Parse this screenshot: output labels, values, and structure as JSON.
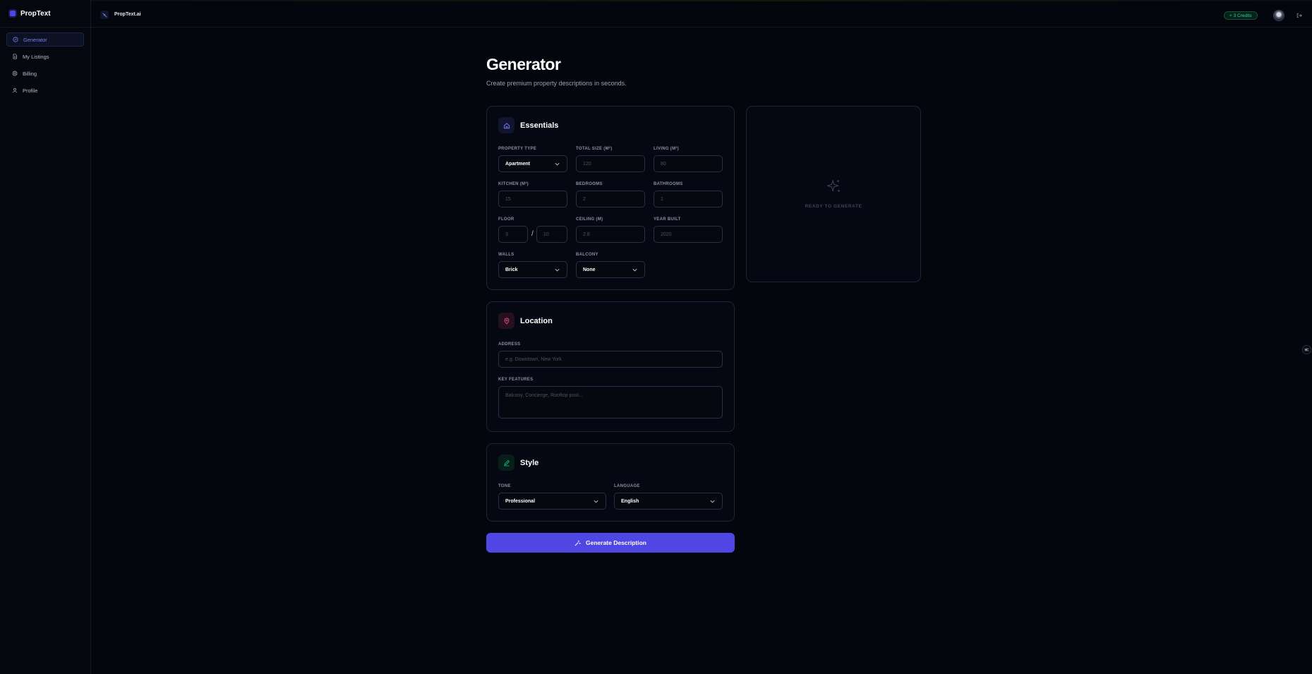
{
  "brand": {
    "name": "PropText"
  },
  "sidebar": {
    "items": [
      {
        "label": "Generator",
        "icon": "sparkle-icon"
      },
      {
        "label": "My Listings",
        "icon": "document-icon"
      },
      {
        "label": "Billing",
        "icon": "coin-icon"
      },
      {
        "label": "Profile",
        "icon": "user-icon"
      }
    ]
  },
  "topbar": {
    "title": "PropText.ai",
    "credits": "+ 3 Credits"
  },
  "page": {
    "title": "Generator",
    "subtitle": "Create premium property descriptions in seconds."
  },
  "essentials": {
    "title": "Essentials",
    "property_type": {
      "label": "PROPERTY TYPE",
      "value": "Apartment"
    },
    "total_size": {
      "label": "TOTAL SIZE (M²)",
      "placeholder": "120"
    },
    "living": {
      "label": "LIVING (M²)",
      "placeholder": "80"
    },
    "kitchen": {
      "label": "KITCHEN (M²)",
      "placeholder": "15"
    },
    "bedrooms": {
      "label": "BEDROOMS",
      "placeholder": "2"
    },
    "bathrooms": {
      "label": "BATHROOMS",
      "placeholder": "1"
    },
    "floor": {
      "label": "FLOOR",
      "placeholder": "3",
      "total_placeholder": "10",
      "separator": "/"
    },
    "ceiling": {
      "label": "CEILING (M)",
      "placeholder": "2.8"
    },
    "year_built": {
      "label": "YEAR BUILT",
      "placeholder": "2020"
    },
    "walls": {
      "label": "WALLS",
      "value": "Brick"
    },
    "balcony": {
      "label": "BALCONY",
      "value": "None"
    }
  },
  "location": {
    "title": "Location",
    "address": {
      "label": "ADDRESS",
      "placeholder": "e.g. Downtown, New York"
    },
    "key_features": {
      "label": "KEY FEATURES",
      "placeholder": "Balcony, Concierge, Rooftop pool..."
    }
  },
  "style": {
    "title": "Style",
    "tone": {
      "label": "TONE",
      "value": "Professional"
    },
    "language": {
      "label": "LANGUAGE",
      "value": "English"
    }
  },
  "actions": {
    "generate_label": "Generate Description"
  },
  "preview": {
    "status": "READY TO GENERATE"
  },
  "colors": {
    "accent": "#5046e4",
    "credits": "#34d399",
    "location_icon": "#ec4899",
    "style_icon": "#10b981"
  }
}
